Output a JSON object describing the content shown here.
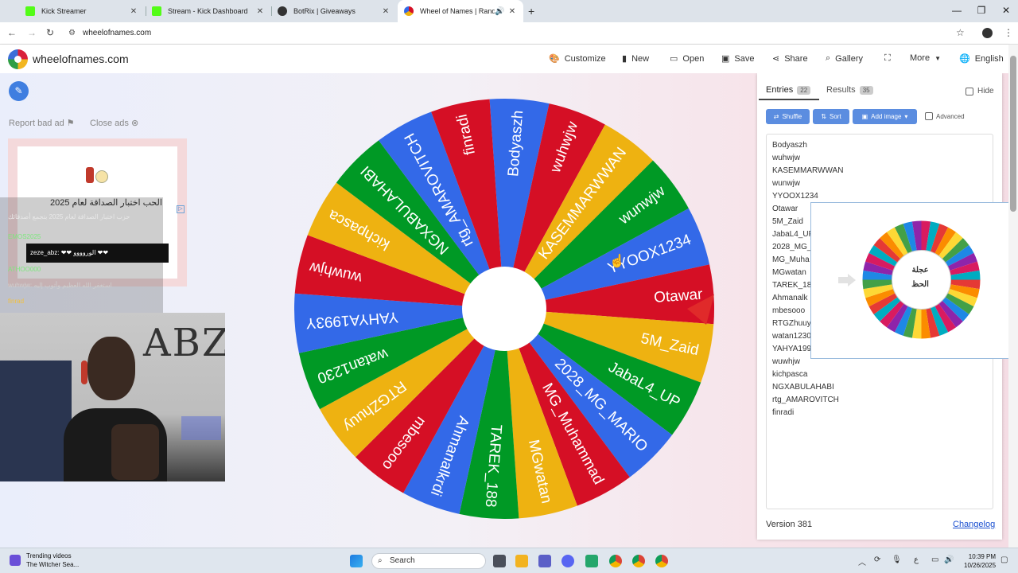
{
  "browser": {
    "tabs": [
      {
        "title": "Kick Streamer",
        "color": "#53fc18"
      },
      {
        "title": "Stream - Kick Dashboard",
        "color": "#53fc18"
      },
      {
        "title": "BotRix | Giveaways",
        "color": "#333333"
      },
      {
        "title": "Wheel of Names | Random",
        "color": "#4285f4"
      }
    ],
    "url": "wheelofnames.com"
  },
  "header": {
    "site_name": "wheelofnames.com",
    "menu": [
      {
        "label": "Customize",
        "icon": "palette-icon"
      },
      {
        "label": "New",
        "icon": "file-icon"
      },
      {
        "label": "Open",
        "icon": "folder-icon"
      },
      {
        "label": "Save",
        "icon": "save-icon"
      },
      {
        "label": "Share",
        "icon": "share-icon"
      },
      {
        "label": "Gallery",
        "icon": "search-icon"
      },
      {
        "label": "",
        "icon": "fullscreen-icon"
      },
      {
        "label": "More",
        "icon": "chevron-down-icon"
      },
      {
        "label": "English",
        "icon": "globe-icon"
      }
    ]
  },
  "left": {
    "report_ad": "Report bad ad",
    "close_ads": "Close ads",
    "ad_title": "الحب اختبار الصداقة لعام 2025",
    "chat": [
      "حزب اختبار الصداقة لعام 2025 بتجمع أصدقائك",
      "EMOS2025",
      "zeze_abz: ❤❤ الوروووو ❤❤",
      "ATHOO000",
      "wuhwjw: استغفر الله العظيم وأتوب إليه",
      "finrad"
    ],
    "webcam_text": "ABZ"
  },
  "wheel": {
    "entries": [
      "Bodyaszh",
      "wuhwjw",
      "KASEMMARWWAN",
      "wunwjw",
      "YYOOX1234",
      "Otawar",
      "5M_Zaid",
      "JabaL4_UP",
      "2028_MG_MARIO",
      "MG_Muhammad",
      "MGwatan",
      "TAREK_188",
      "Ahmanalkrdi",
      "mbesooo",
      "RTGZhuuy",
      "watan1230",
      "YAHYA1993Y",
      "wuwhjw",
      "kichpasca",
      "NGXABULAHABI",
      "rtg_AMAROVITCH",
      "finradi"
    ],
    "colors": [
      "#3369e8",
      "#d50f25",
      "#eeb211",
      "#009925"
    ]
  },
  "panel": {
    "tab_entries": "Entries",
    "entries_count": "22",
    "tab_results": "Results",
    "results_count": "35",
    "hide": "Hide",
    "shuffle": "Shuffle",
    "sort": "Sort",
    "add_image": "Add image",
    "advanced": "Advanced",
    "entries": [
      "Bodyaszh",
      "wuhwjw",
      "KASEMMARWWAN",
      "wunwjw",
      "YYOOX1234",
      "Otawar",
      "5M_Zaid",
      "JabaL4_UF",
      "2028_MG_",
      "MG_Muha",
      "MGwatan",
      "TAREK_18",
      "Ahmanalk",
      "mbesooo",
      "RTGZhuuy",
      "watan1230",
      "YAHYA199",
      "wuwhjw",
      "kichpasca",
      "NGXABULAHABI",
      "rtg_AMAROVITCH",
      "finradi"
    ],
    "version": "Version 381",
    "changelog": "Changelog"
  },
  "popup": {
    "title_line1": "عجلة",
    "title_line2": "الحظ"
  },
  "taskbar": {
    "trend_title": "Trending videos",
    "trend_sub": "The Witcher Sea...",
    "search": "Search",
    "time": "10:39 PM",
    "date": "10/26/2025",
    "lang": "ع"
  }
}
